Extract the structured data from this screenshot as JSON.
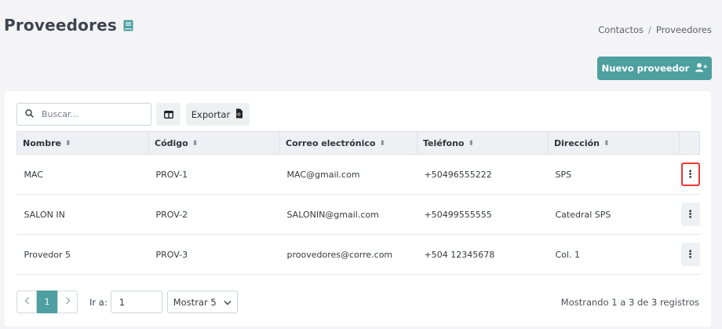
{
  "header": {
    "title": "Proveedores",
    "title_icon": "book-icon",
    "breadcrumb": [
      "Contactos",
      "Proveedores"
    ],
    "new_button_label": "Nuevo proveedor",
    "new_button_icon": "user-plus-icon"
  },
  "toolbar": {
    "search_placeholder": "Buscar...",
    "export_label": "Exportar"
  },
  "table": {
    "columns": [
      "Nombre",
      "Código",
      "Correo electrónico",
      "Teléfono",
      "Dirección"
    ],
    "rows": [
      [
        "MAC",
        "PROV-1",
        "MAC@gmail.com",
        "+50496555222",
        "SPS"
      ],
      [
        "SALON IN",
        "PROV-2",
        "SALONIN@gmail.com",
        "+50499555555",
        "Catedral SPS"
      ],
      [
        "Provedor 5",
        "PROV-3",
        "proovedores@corre.com",
        "+504 12345678",
        "Col. 1"
      ]
    ],
    "action_glyph": "⋮"
  },
  "pagination": {
    "current_page": "1",
    "goto_label": "Ir a:",
    "goto_value": "1",
    "page_size_label": "Mostrar 5",
    "summary": "Mostrando 1 a 3 de 3 registros"
  },
  "colors": {
    "accent": "#4e9f9f",
    "highlight": "#e53935"
  }
}
